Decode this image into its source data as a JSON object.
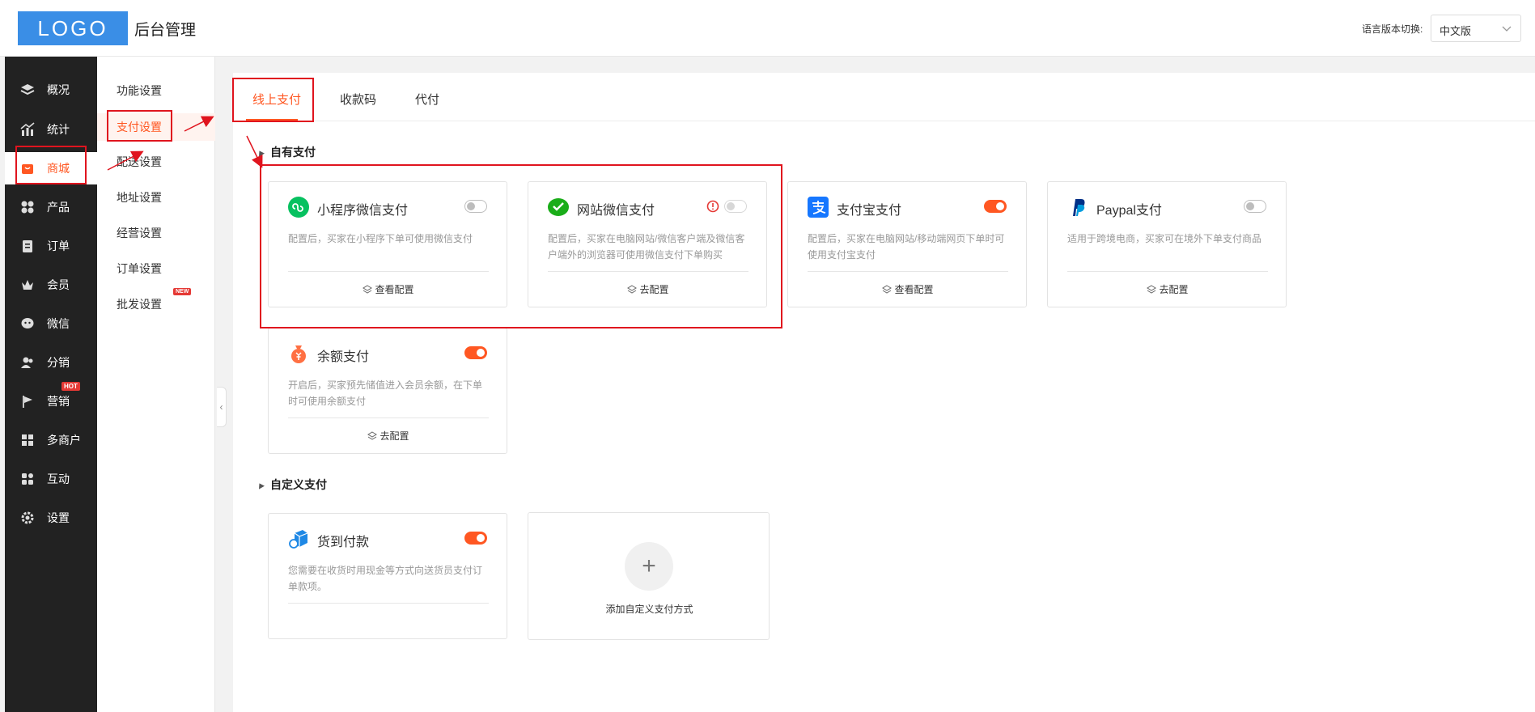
{
  "header": {
    "logo": "LOGO",
    "title": "后台管理",
    "lang_label": "语言版本切换:",
    "lang_value": "中文版"
  },
  "sidebar": {
    "items": [
      {
        "label": "概况",
        "icon": "layers-icon"
      },
      {
        "label": "统计",
        "icon": "chart-icon"
      },
      {
        "label": "商城",
        "icon": "shop-icon"
      },
      {
        "label": "产品",
        "icon": "grid-icon"
      },
      {
        "label": "订单",
        "icon": "clipboard-icon"
      },
      {
        "label": "会员",
        "icon": "crown-icon"
      },
      {
        "label": "微信",
        "icon": "wechat-icon"
      },
      {
        "label": "分销",
        "icon": "users-icon"
      },
      {
        "label": "营销",
        "icon": "flag-icon",
        "badge": "HOT"
      },
      {
        "label": "多商户",
        "icon": "store-icon"
      },
      {
        "label": "互动",
        "icon": "apps-icon"
      },
      {
        "label": "设置",
        "icon": "gear-icon"
      }
    ]
  },
  "submenu": {
    "items": [
      {
        "label": "功能设置"
      },
      {
        "label": "支付设置"
      },
      {
        "label": "配送设置"
      },
      {
        "label": "地址设置"
      },
      {
        "label": "经营设置"
      },
      {
        "label": "订单设置"
      },
      {
        "label": "批发设置",
        "badge": "NEW"
      }
    ]
  },
  "tabs": [
    {
      "label": "线上支付"
    },
    {
      "label": "收款码"
    },
    {
      "label": "代付"
    }
  ],
  "sections": {
    "own": "自有支付",
    "custom": "自定义支付"
  },
  "cards": [
    {
      "title": "小程序微信支付",
      "desc": "配置后，买家在小程序下单可使用微信支付",
      "action": "查看配置",
      "enabled": false
    },
    {
      "title": "网站微信支付",
      "desc": "配置后，买家在电脑网站/微信客户端及微信客户端外的浏览器可使用微信支付下单购买",
      "action": "去配置",
      "enabled": false
    },
    {
      "title": "支付宝支付",
      "desc": "配置后，买家在电脑网站/移动端网页下单时可使用支付宝支付",
      "action": "查看配置",
      "enabled": true
    },
    {
      "title": "Paypal支付",
      "desc": "适用于跨境电商，买家可在境外下单支付商品",
      "action": "去配置",
      "enabled": false
    },
    {
      "title": "余额支付",
      "desc": "开启后，买家预先储值进入会员余额，在下单时可使用余额支付",
      "action": "去配置",
      "enabled": true
    },
    {
      "title": "货到付款",
      "desc": "您需要在收货时用现金等方式向送货员支付订单款项。",
      "enabled": true
    }
  ],
  "add_custom": {
    "label": "添加自定义支付方式"
  },
  "colors": {
    "accent": "#ff5722",
    "annotation": "#e0141e",
    "sidebar": "#222222",
    "logo": "#3a8ee6"
  }
}
